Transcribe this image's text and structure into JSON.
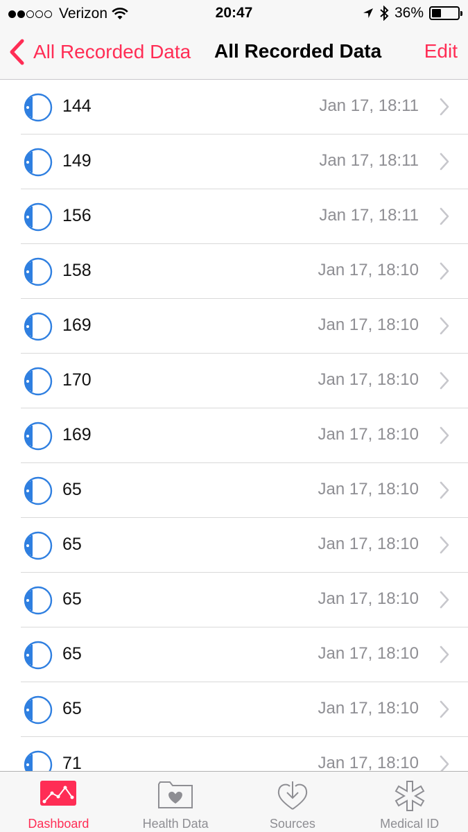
{
  "status": {
    "carrier": "Verizon",
    "time": "20:47",
    "battery": "36%",
    "battery_level": 0.36
  },
  "nav": {
    "back_label": "All Recorded Data",
    "title": "All Recorded Data",
    "edit_label": "Edit"
  },
  "accent_color": "#ff2d55",
  "icon_color": "#2f7fe0",
  "records": [
    {
      "value": "144",
      "date": "Jan 17, 18:11"
    },
    {
      "value": "149",
      "date": "Jan 17, 18:11"
    },
    {
      "value": "156",
      "date": "Jan 17, 18:11"
    },
    {
      "value": "158",
      "date": "Jan 17, 18:10"
    },
    {
      "value": "169",
      "date": "Jan 17, 18:10"
    },
    {
      "value": "170",
      "date": "Jan 17, 18:10"
    },
    {
      "value": "169",
      "date": "Jan 17, 18:10"
    },
    {
      "value": "65",
      "date": "Jan 17, 18:10"
    },
    {
      "value": "65",
      "date": "Jan 17, 18:10"
    },
    {
      "value": "65",
      "date": "Jan 17, 18:10"
    },
    {
      "value": "65",
      "date": "Jan 17, 18:10"
    },
    {
      "value": "65",
      "date": "Jan 17, 18:10"
    },
    {
      "value": "71",
      "date": "Jan 17, 18:10"
    }
  ],
  "tabs": [
    {
      "label": "Dashboard",
      "icon": "dashboard-icon",
      "active": true
    },
    {
      "label": "Health Data",
      "icon": "health-data-icon",
      "active": false
    },
    {
      "label": "Sources",
      "icon": "sources-icon",
      "active": false
    },
    {
      "label": "Medical ID",
      "icon": "medical-id-icon",
      "active": false
    }
  ]
}
